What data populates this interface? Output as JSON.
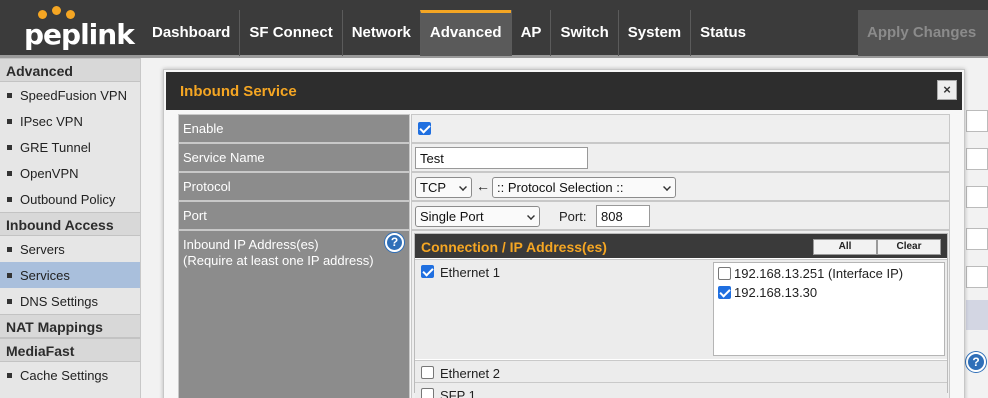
{
  "brand": {
    "name": "peplink",
    "accent": "#f5a623"
  },
  "nav": {
    "items": [
      "Dashboard",
      "SF Connect",
      "Network",
      "Advanced",
      "AP",
      "Switch",
      "System",
      "Status"
    ],
    "active": "Advanced",
    "apply_label": "Apply Changes"
  },
  "sidebar": {
    "sections": [
      {
        "title": "Advanced",
        "items": [
          "SpeedFusion VPN",
          "IPsec VPN",
          "GRE Tunnel",
          "OpenVPN",
          "Outbound Policy"
        ]
      },
      {
        "title": "Inbound Access",
        "items": [
          "Servers",
          "Services",
          "DNS Settings"
        ]
      },
      {
        "title": "NAT Mappings",
        "items": []
      },
      {
        "title": "MediaFast",
        "items": [
          "Cache Settings"
        ]
      }
    ],
    "active_item": "Services"
  },
  "dialog": {
    "title": "Inbound Service",
    "close_icon": "close-icon",
    "enable": {
      "label": "Enable",
      "checked": true
    },
    "service_name": {
      "label": "Service Name",
      "value": "Test"
    },
    "protocol": {
      "label": "Protocol",
      "value": "TCP",
      "selection_value": ":: Protocol Selection ::",
      "arrow_glyph": "←"
    },
    "port": {
      "label": "Port",
      "type_value": "Single Port",
      "port_label": "Port:",
      "port_value": "808"
    },
    "inbound_ip": {
      "label": "Inbound IP Address(es)\n(Require at least one IP address)",
      "help_glyph": "?",
      "connection_header": "Connection / IP Address(es)",
      "all_label": "All",
      "clear_label": "Clear",
      "interfaces": [
        {
          "name": "Ethernet 1",
          "checked": true,
          "ips": [
            {
              "ip": "192.168.13.251 (Interface IP)",
              "checked": false
            },
            {
              "ip": "192.168.13.30",
              "checked": true
            }
          ]
        },
        {
          "name": "Ethernet 2",
          "checked": false,
          "ips": []
        },
        {
          "name": "SFP 1",
          "checked": false,
          "ips": []
        }
      ]
    }
  }
}
